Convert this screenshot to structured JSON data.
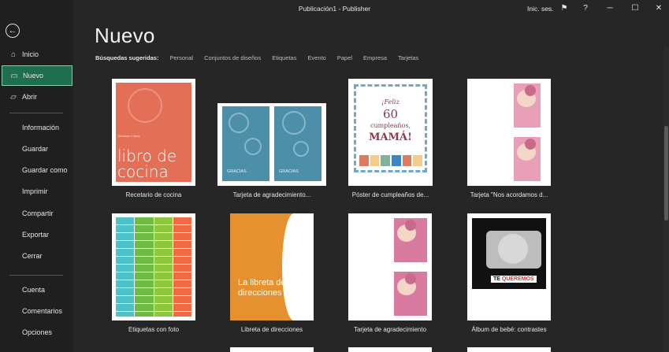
{
  "window": {
    "title": "Publicación1  -  Publisher",
    "signin": "Inic. ses.",
    "help": "?"
  },
  "sidebar": {
    "items": [
      {
        "label": "Inicio",
        "icon": "home-icon",
        "glyph": "⌂"
      },
      {
        "label": "Nuevo",
        "icon": "new-document-icon",
        "glyph": "▭"
      },
      {
        "label": "Abrir",
        "icon": "folder-open-icon",
        "glyph": "▱"
      }
    ],
    "items2": [
      {
        "label": "Información"
      },
      {
        "label": "Guardar"
      },
      {
        "label": "Guardar como"
      },
      {
        "label": "Imprimir"
      },
      {
        "label": "Compartir"
      },
      {
        "label": "Exportar"
      },
      {
        "label": "Cerrar"
      }
    ],
    "items3": [
      {
        "label": "Cuenta"
      },
      {
        "label": "Comentarios"
      },
      {
        "label": "Opciones"
      }
    ]
  },
  "main": {
    "title": "Nuevo",
    "suggested_label": "Búsquedas sugeridas:",
    "suggested": [
      "Personal",
      "Conjuntos de diseños",
      "Etiquetas",
      "Evento",
      "Papel",
      "Empresa",
      "Tarjetas"
    ]
  },
  "templates": [
    {
      "label": "Recetario de cocina",
      "thumb_title": "libro de cocina",
      "thumb_sub": "Nombre o título"
    },
    {
      "label": "Tarjeta de agradecimiento...",
      "thumb_text": "GRACIAS"
    },
    {
      "label": "Póster de cumpleaños de...",
      "thumb_lines": [
        "¡Feliz",
        "60",
        "cumpleaños,",
        "MAMÁ!"
      ]
    },
    {
      "label": "Tarjeta \"Nos acordamos d..."
    },
    {
      "label": "Etiquetas con foto"
    },
    {
      "label": "Libreta de direcciones",
      "thumb_title": "La libreta de direcciones"
    },
    {
      "label": "Tarjeta de agradecimiento"
    },
    {
      "label": "Álbum de bebé: contrastes",
      "thumb_text_a": "TE ",
      "thumb_text_b": "QUEREMOS"
    }
  ],
  "colors": {
    "accent": "#1e6f4f",
    "accent_border": "#7fd1a8",
    "background": "#262626",
    "sidebar": "#1f1f1f"
  }
}
